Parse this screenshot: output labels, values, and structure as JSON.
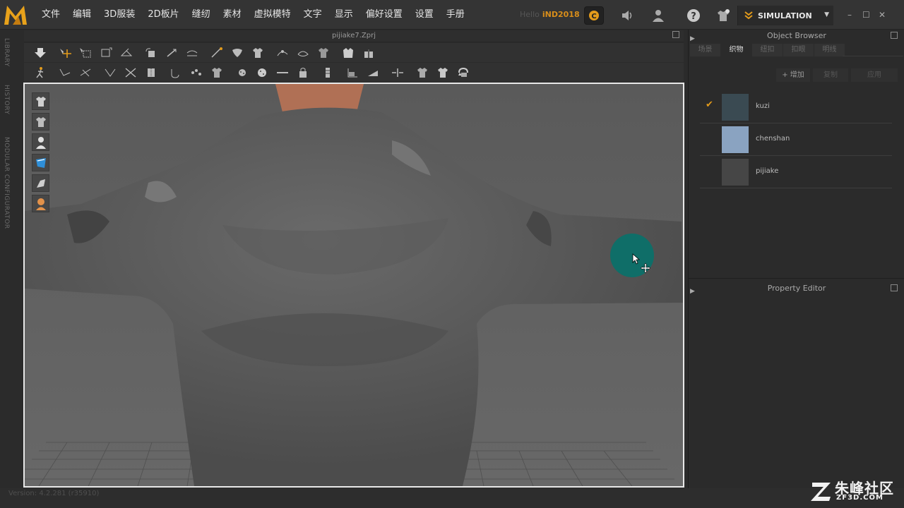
{
  "app": {
    "logo_text": "M"
  },
  "menu": [
    "文件",
    "编辑",
    "3D服装",
    "2D板片",
    "缝纫",
    "素材",
    "虚拟模特",
    "文字",
    "显示",
    "偏好设置",
    "设置",
    "手册"
  ],
  "user": {
    "hello": "Hello",
    "name": "iND2018"
  },
  "mode": {
    "label": "SIMULATION"
  },
  "sidebar_tabs": [
    "LIBRARY",
    "HISTORY",
    "MODULAR CONFIGURATOR"
  ],
  "document": {
    "title": "pijiake7.Zprj"
  },
  "object_browser": {
    "title": "Object Browser",
    "tabs": [
      "场景",
      "织物",
      "纽扣",
      "扣眼",
      "明线"
    ],
    "active_tab": "织物",
    "buttons": {
      "add": "+ 增加",
      "copy": "复制",
      "apply": "应用"
    },
    "items": [
      {
        "name": "kuzi",
        "color": "#3a4a52",
        "checked": true
      },
      {
        "name": "chenshan",
        "color": "#8aa3c1",
        "checked": false
      },
      {
        "name": "pijiake",
        "color": "#464646",
        "checked": false
      }
    ]
  },
  "property_editor": {
    "title": "Property Editor"
  },
  "status": {
    "version": "Version: 4.2.281 (r35910)"
  },
  "watermark": {
    "cn": "朱峰社区",
    "en": "ZF3D.COM"
  },
  "colors": {
    "accent": "#e39b1b",
    "cursor": "#0f6e68",
    "viewport_border": "#e8e8e8"
  }
}
